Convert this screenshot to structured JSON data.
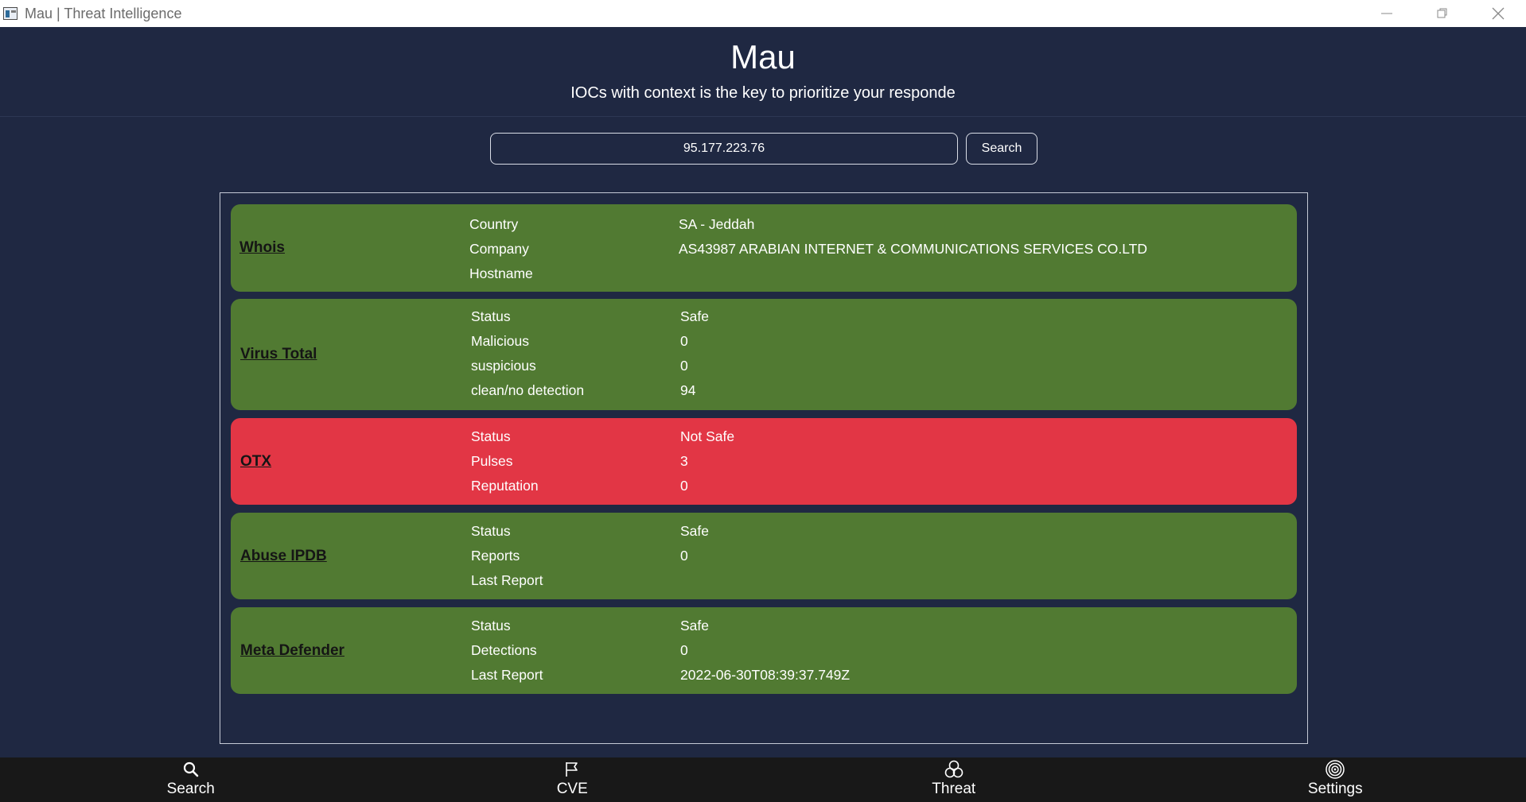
{
  "window": {
    "title": "Mau | Threat Intelligence",
    "controls": [
      "minimize-icon",
      "restore-icon",
      "close-icon"
    ]
  },
  "header": {
    "title": "Mau",
    "subtitle": "IOCs with context is the key to prioritize your responde"
  },
  "search": {
    "value": "95.177.223.76",
    "button_label": "Search"
  },
  "cards": [
    {
      "title": "Whois",
      "status_color": "#517a32",
      "rows": [
        {
          "key": "Country",
          "value": "SA - Jeddah"
        },
        {
          "key": "Company",
          "value": "AS43987 ARABIAN INTERNET & COMMUNICATIONS SERVICES CO.LTD"
        },
        {
          "key": "Hostname",
          "value": ""
        }
      ]
    },
    {
      "title": "Virus Total",
      "status_color": "#517a32",
      "rows": [
        {
          "key": "Status",
          "value": "Safe"
        },
        {
          "key": "Malicious",
          "value": "0"
        },
        {
          "key": "suspicious",
          "value": "0"
        },
        {
          "key": "clean/no detection",
          "value": "94"
        }
      ]
    },
    {
      "title": "OTX",
      "status_color": "#e23645",
      "rows": [
        {
          "key": "Status",
          "value": "Not Safe"
        },
        {
          "key": "Pulses",
          "value": "3"
        },
        {
          "key": "Reputation",
          "value": "0"
        }
      ]
    },
    {
      "title": "Abuse IPDB",
      "status_color": "#517a32",
      "rows": [
        {
          "key": "Status",
          "value": "Safe"
        },
        {
          "key": "Reports",
          "value": "0"
        },
        {
          "key": "Last Report",
          "value": ""
        }
      ]
    },
    {
      "title": "Meta Defender",
      "status_color": "#517a32",
      "rows": [
        {
          "key": "Status",
          "value": "Safe"
        },
        {
          "key": "Detections",
          "value": "0"
        },
        {
          "key": "Last Report",
          "value": "2022-06-30T08:39:37.749Z"
        }
      ]
    }
  ],
  "nav": [
    {
      "label": "Search",
      "icon": "search-icon"
    },
    {
      "label": "CVE",
      "icon": "flag-icon"
    },
    {
      "label": "Threat",
      "icon": "biohazard-icon"
    },
    {
      "label": "Settings",
      "icon": "target-icon"
    }
  ],
  "colors": {
    "background": "#1f2842",
    "safe": "#517a32",
    "alert": "#e23645",
    "nav_background": "#181818"
  }
}
